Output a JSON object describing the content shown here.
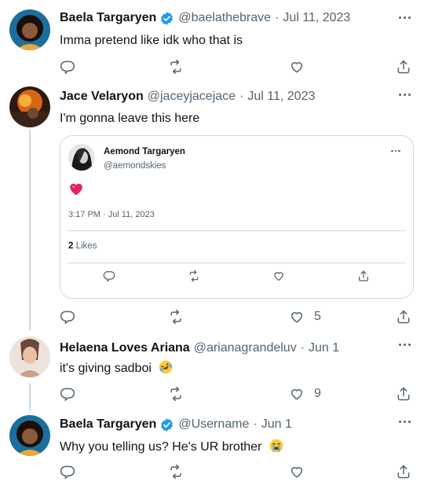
{
  "tweets": [
    {
      "name": "Baela Targaryen",
      "verified": true,
      "handle": "@baelathebrave",
      "dot": "·",
      "date": "Jul 11, 2023",
      "text": "Imma pretend like idk who that is",
      "likes": ""
    },
    {
      "name": "Jace Velaryon",
      "verified": false,
      "handle": "@jaceyjacejace",
      "dot": "·",
      "date": "Jul 11, 2023",
      "text": "I'm gonna leave this here",
      "likes": "5"
    },
    {
      "name": "Helaena Loves Ariana",
      "verified": false,
      "handle": "@arianagrandeluv",
      "dot": "·",
      "date": "Jun 1",
      "text": "it's giving sadboi",
      "emoji": "rolling-on-floor-laughing-emoji",
      "likes": "9"
    },
    {
      "name": "Baela Targaryen",
      "verified": true,
      "handle": "@Username",
      "dot": "·",
      "date": "Jun 1",
      "text": "Why you telling us? He's UR brother",
      "emoji": "loudly-crying-face-emoji",
      "likes": ""
    }
  ],
  "quoted_tweet": {
    "name": "Aemond Targaryen",
    "handle": "@aemondskies",
    "content_icon": "red-heart-emoji",
    "timestamp": "3:17 PM · Jul 11, 2023",
    "likes_count": "2",
    "likes_label": "Likes"
  },
  "colors": {
    "text": "#0f1419",
    "secondary": "#536471",
    "border": "#cfd9de",
    "verified": "#1d9bf0",
    "heart": "#e0245e"
  }
}
